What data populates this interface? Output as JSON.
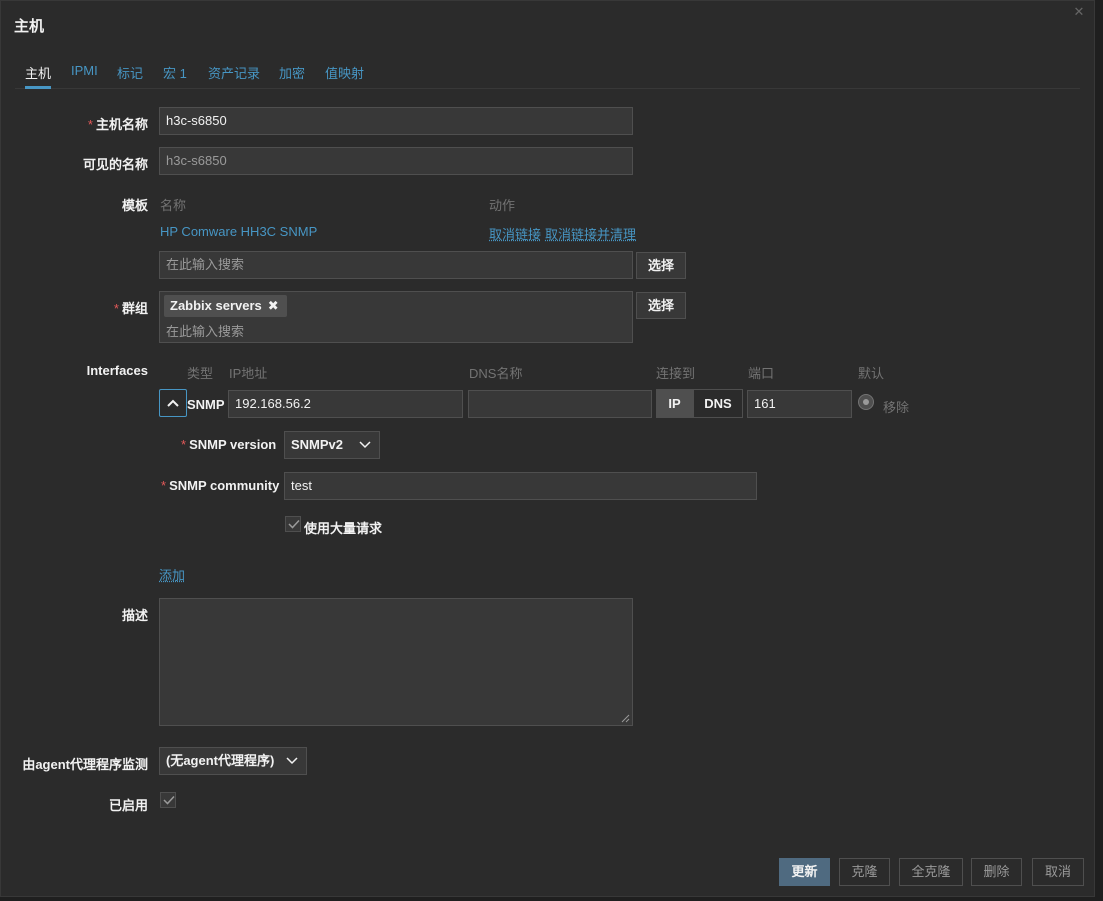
{
  "dialog": {
    "title": "主机"
  },
  "tabs": [
    "主机",
    "IPMI",
    "标记",
    "宏 1",
    "资产记录",
    "加密",
    "值映射"
  ],
  "form": {
    "host_name_label": "主机名称",
    "host_name_value": "h3c-s6850",
    "visible_name_label": "可见的名称",
    "visible_name_value": "h3c-s6850",
    "templates_label": "模板",
    "templates_col_name": "名称",
    "templates_col_action": "动作",
    "template_item": "HP Comware HH3C SNMP",
    "unlink_label": "取消链接",
    "unlink_clear_label": "取消链接并清理",
    "search_placeholder": "在此输入搜索",
    "select_button": "选择",
    "groups_label": "群组",
    "group_chip": "Zabbix servers",
    "group_chip_remove": "✖",
    "interfaces_label": "Interfaces",
    "iface_cols": {
      "type": "类型",
      "ip": "IP地址",
      "dns": "DNS名称",
      "connect_to": "连接到",
      "port": "端口",
      "default": "默认"
    },
    "iface_type": "SNMP",
    "iface_ip": "192.168.56.2",
    "iface_dns": "",
    "connect_ip": "IP",
    "connect_dns": "DNS",
    "iface_port": "161",
    "iface_remove": "移除",
    "snmp_version_label": "SNMP version",
    "snmp_version_value": "SNMPv2",
    "snmp_community_label": "SNMP community",
    "snmp_community_value": "test",
    "bulk_label": "使用大量请求",
    "add_label": "添加",
    "description_label": "描述",
    "proxy_label": "由agent代理程序监测",
    "proxy_value": "(无agent代理程序)",
    "enabled_label": "已启用"
  },
  "footer": {
    "update": "更新",
    "clone": "克隆",
    "full_clone": "全克隆",
    "delete": "删除",
    "cancel": "取消"
  },
  "colors": {
    "accent": "#4796c4",
    "required": "#e45959",
    "background": "#2b2b2b"
  }
}
